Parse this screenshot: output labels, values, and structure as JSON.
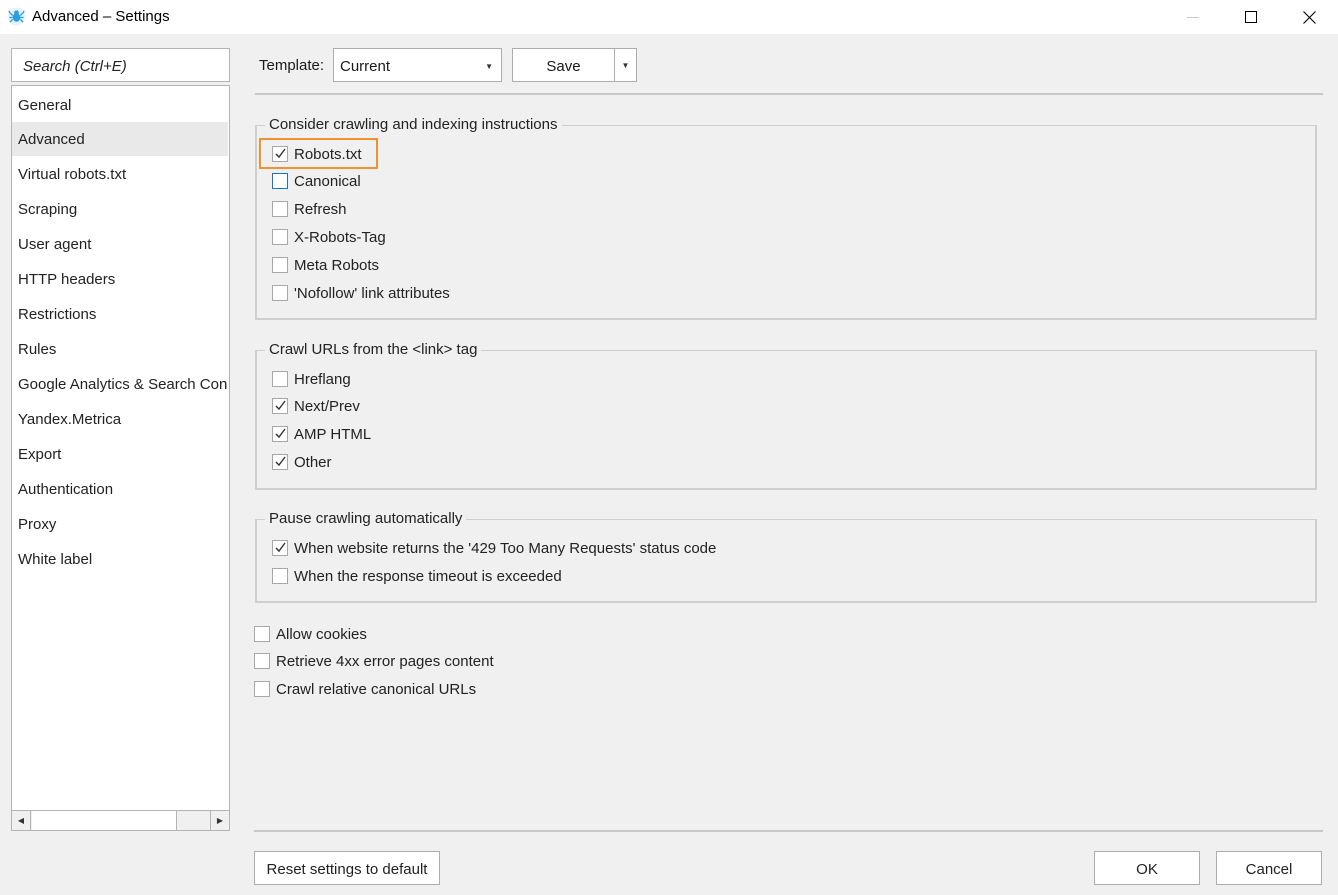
{
  "window": {
    "title": "Advanced – Settings",
    "icon": "spider-logo-icon",
    "controls": {
      "minimize": "minimize-icon",
      "maximize": "maximize-icon",
      "close": "close-icon"
    }
  },
  "sidebar": {
    "search_placeholder": "Search (Ctrl+E)",
    "selected": "Advanced",
    "items": [
      {
        "label": "General"
      },
      {
        "label": "Advanced"
      },
      {
        "label": "Virtual robots.txt"
      },
      {
        "label": "Scraping"
      },
      {
        "label": "User agent"
      },
      {
        "label": "HTTP headers"
      },
      {
        "label": "Restrictions"
      },
      {
        "label": "Rules"
      },
      {
        "label": "Google Analytics & Search Console"
      },
      {
        "label": "Yandex.Metrica"
      },
      {
        "label": "Export"
      },
      {
        "label": "Authentication"
      },
      {
        "label": "Proxy"
      },
      {
        "label": "White label"
      }
    ],
    "scrollbar": {
      "left_arrow": "◀",
      "right_arrow": "▶"
    }
  },
  "toolbar": {
    "template_label": "Template:",
    "template_value": "Current",
    "dropdown_caret": "▼",
    "save_label": "Save"
  },
  "groups": [
    {
      "legend": "Consider crawling and indexing instructions",
      "options": [
        {
          "label": "Robots.txt",
          "checked": true,
          "highlighted": true
        },
        {
          "label": "Canonical",
          "checked": false,
          "focused": true
        },
        {
          "label": "Refresh",
          "checked": false
        },
        {
          "label": "X-Robots-Tag",
          "checked": false
        },
        {
          "label": "Meta Robots",
          "checked": false
        },
        {
          "label": "'Nofollow' link attributes",
          "checked": false
        }
      ]
    },
    {
      "legend": "Crawl URLs from the <link> tag",
      "options": [
        {
          "label": "Hreflang",
          "checked": false
        },
        {
          "label": "Next/Prev",
          "checked": true
        },
        {
          "label": "AMP HTML",
          "checked": true
        },
        {
          "label": "Other",
          "checked": true
        }
      ]
    },
    {
      "legend": "Pause crawling automatically",
      "options": [
        {
          "label": "When website returns the '429 Too Many Requests' status code",
          "checked": true
        },
        {
          "label": "When the response timeout is exceeded",
          "checked": false
        }
      ]
    }
  ],
  "standalone_options": [
    {
      "label": "Allow cookies",
      "checked": false
    },
    {
      "label": "Retrieve 4xx error pages content",
      "checked": false
    },
    {
      "label": "Crawl relative canonical URLs",
      "checked": false
    }
  ],
  "footer": {
    "reset_label": "Reset settings to default",
    "ok_label": "OK",
    "cancel_label": "Cancel"
  },
  "colors": {
    "highlight_outline": "#f0922e",
    "focus_border": "#1a73c8",
    "selected_item_bg": "#e9e9e9",
    "icon_blue": "#2a9fe0"
  }
}
